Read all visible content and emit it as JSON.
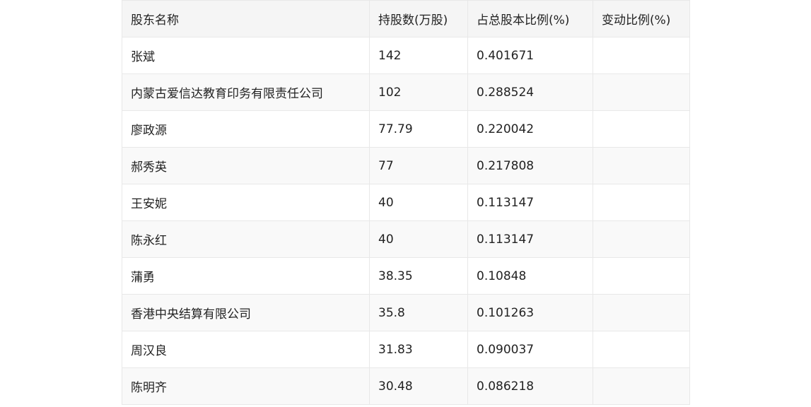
{
  "table": {
    "headers": [
      "股东名称",
      "持股数(万股)",
      "占总股本比例(%)",
      "变动比例(%)"
    ],
    "rows": [
      [
        "张斌",
        "142",
        "0.401671",
        ""
      ],
      [
        "内蒙古爱信达教育印务有限责任公司",
        "102",
        "0.288524",
        ""
      ],
      [
        "廖政源",
        "77.79",
        "0.220042",
        ""
      ],
      [
        "郝秀英",
        "77",
        "0.217808",
        ""
      ],
      [
        "王安妮",
        "40",
        "0.113147",
        ""
      ],
      [
        "陈永红",
        "40",
        "0.113147",
        ""
      ],
      [
        "蒲勇",
        "38.35",
        "0.10848",
        ""
      ],
      [
        "香港中央结算有限公司",
        "35.8",
        "0.101263",
        ""
      ],
      [
        "周汉良",
        "31.83",
        "0.090037",
        ""
      ],
      [
        "陈明齐",
        "30.48",
        "0.086218",
        ""
      ]
    ]
  }
}
